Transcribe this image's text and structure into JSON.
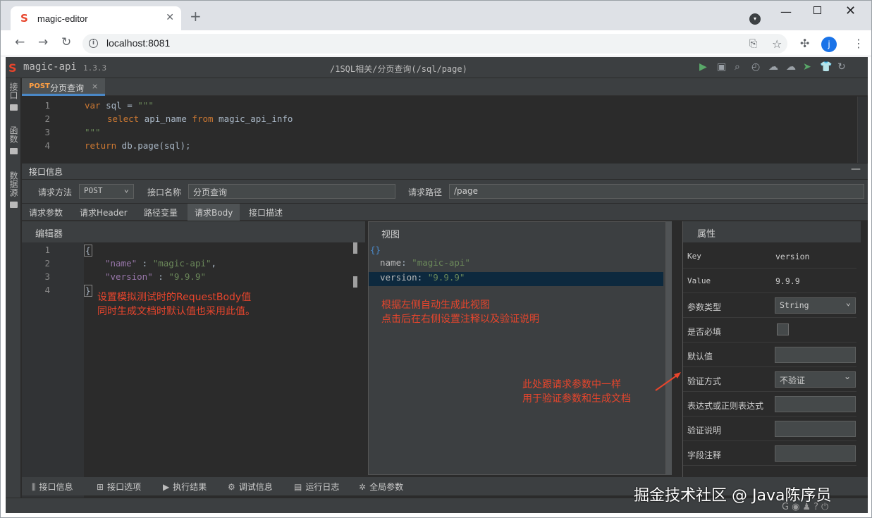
{
  "browser": {
    "tab_title": "magic-editor",
    "url": "localhost:8081",
    "avatar_letter": "j",
    "new_tab_label": "+"
  },
  "app": {
    "name": "magic-api",
    "version": "1.3.3",
    "breadcrumb": "/1SQL相关/分页查询(/sql/page)"
  },
  "sidebar": [
    {
      "label": "接口",
      "icon": "folder-icon"
    },
    {
      "label": "函数",
      "icon": "folder-icon"
    },
    {
      "label": "数据源",
      "icon": "folder-icon"
    }
  ],
  "editor_tab": {
    "method": "POST",
    "name": "分页查询",
    "close": "×"
  },
  "code": {
    "line_numbers": [
      "1",
      "2",
      "3",
      "4"
    ],
    "l1_kw": "var",
    "l1_rest": " sql = ",
    "l1_str": "\"\"\"",
    "l2_kw1": "select",
    "l2_mid": " api_name ",
    "l2_kw2": "from",
    "l2_rest": " magic_api_info",
    "l3_str": "\"\"\"",
    "l4_kw": "return",
    "l4_rest": " db.page(sql);"
  },
  "info_section": {
    "title": "接口信息",
    "method_label": "请求方法",
    "method_value": "POST",
    "name_label": "接口名称",
    "name_value": "分页查询",
    "path_label": "请求路径",
    "path_value": "/page"
  },
  "request_tabs": [
    "请求参数",
    "请求Header",
    "路径变量",
    "请求Body",
    "接口描述"
  ],
  "body_editor": {
    "title": "编辑器",
    "line_numbers": [
      "1",
      "2",
      "3",
      "4"
    ],
    "open_brace": "{",
    "key1": "\"name\"",
    "sep1": " : ",
    "val1": "\"magic-api\"",
    "comma1": ",",
    "key2": "\"version\"",
    "sep2": " : ",
    "val2": "\"9.9.9\"",
    "close_brace": "}",
    "note_line1": "设置模拟测试时的RequestBody值",
    "note_line2": "同时生成文档时默认值也采用此值。"
  },
  "view_panel": {
    "title": "视图",
    "root": "{}",
    "row1_key": "name",
    "row1_val": "\"magic-api\"",
    "row2_key": "version",
    "row2_val": "\"9.9.9\"",
    "colon": ": ",
    "note_line1": "根据左侧自动生成此视图",
    "note_line2": "点击后在右侧设置注释以及验证说明"
  },
  "properties": {
    "title": "属性",
    "key_label": "Key",
    "key_value": "version",
    "value_label": "Value",
    "value_value": "9.9.9",
    "type_label": "参数类型",
    "type_value": "String",
    "required_label": "是否必填",
    "default_label": "默认值",
    "validate_label": "验证方式",
    "validate_value": "不验证",
    "expr_label": "表达式或正则表达式",
    "validate_desc_label": "验证说明",
    "field_comment_label": "字段注释",
    "note_line1": "此处跟请求参数中一样",
    "note_line2": "用于验证参数和生成文档"
  },
  "bottom_tabs": [
    {
      "label": "接口信息",
      "icon": "bars-icon"
    },
    {
      "label": "接口选项",
      "icon": "grid-icon"
    },
    {
      "label": "执行结果",
      "icon": "play-icon"
    },
    {
      "label": "调试信息",
      "icon": "bug-icon"
    },
    {
      "label": "运行日志",
      "icon": "log-icon"
    },
    {
      "label": "全局参数",
      "icon": "gear-icon"
    }
  ],
  "watermark": "掘金技术社区 @ Java陈序员",
  "colors": {
    "accent": "#4a88c7",
    "annotation": "#e8452c",
    "post": "#ff9f43"
  }
}
